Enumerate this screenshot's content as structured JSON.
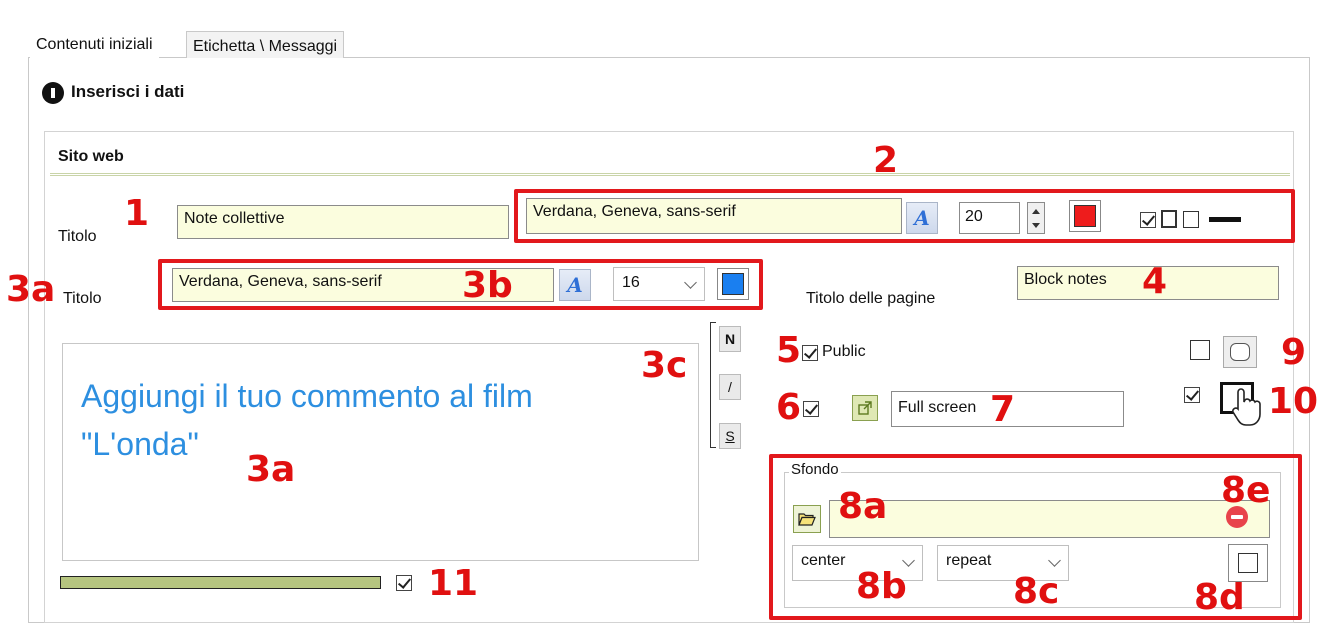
{
  "tabs": [
    {
      "label": "Contenuti iniziali",
      "active": true
    },
    {
      "label": "Etichetta \\ Messaggi",
      "active": false
    }
  ],
  "step": {
    "label": "Inserisci i dati"
  },
  "section": {
    "title": "Sito web"
  },
  "row1": {
    "label": "Titolo",
    "title_value": "Note collettive",
    "font_value": "Verdana, Geneva, sans-serif",
    "font_size": "20",
    "color": "#ee1c1c"
  },
  "row2": {
    "label": "Titolo",
    "font_value": "Verdana, Geneva, sans-serif",
    "font_size": "16",
    "color": "#1a7ff0"
  },
  "page_title": {
    "label": "Titolo delle pagine",
    "value": "Block notes"
  },
  "comment": {
    "line1": "Aggiungi il tuo commento al film",
    "line2": "\"L'onda\""
  },
  "style_buttons": {
    "bold": "N",
    "italic": "/",
    "strike": "S"
  },
  "public": {
    "label": "Public",
    "checked": true
  },
  "fullscreen": {
    "checked": true,
    "value": "Full screen"
  },
  "background": {
    "legend": "Sfondo",
    "file_value": "",
    "position": "center",
    "repeat": "repeat"
  },
  "annotations": {
    "n1": "1",
    "n2": "2",
    "n3a_left": "3a",
    "n3b": "3b",
    "n3c": "3c",
    "n3a_area": "3a",
    "n4": "4",
    "n5": "5",
    "n6": "6",
    "n7": "7",
    "n8a": "8a",
    "n8b": "8b",
    "n8c": "8c",
    "n8d": "8d",
    "n8e": "8e",
    "n9": "9",
    "n10": "10",
    "n11": "11"
  },
  "colors": {
    "annotation": "#e01010",
    "field_bg": "#fbfdde",
    "accent_bar": "#b6c580"
  }
}
